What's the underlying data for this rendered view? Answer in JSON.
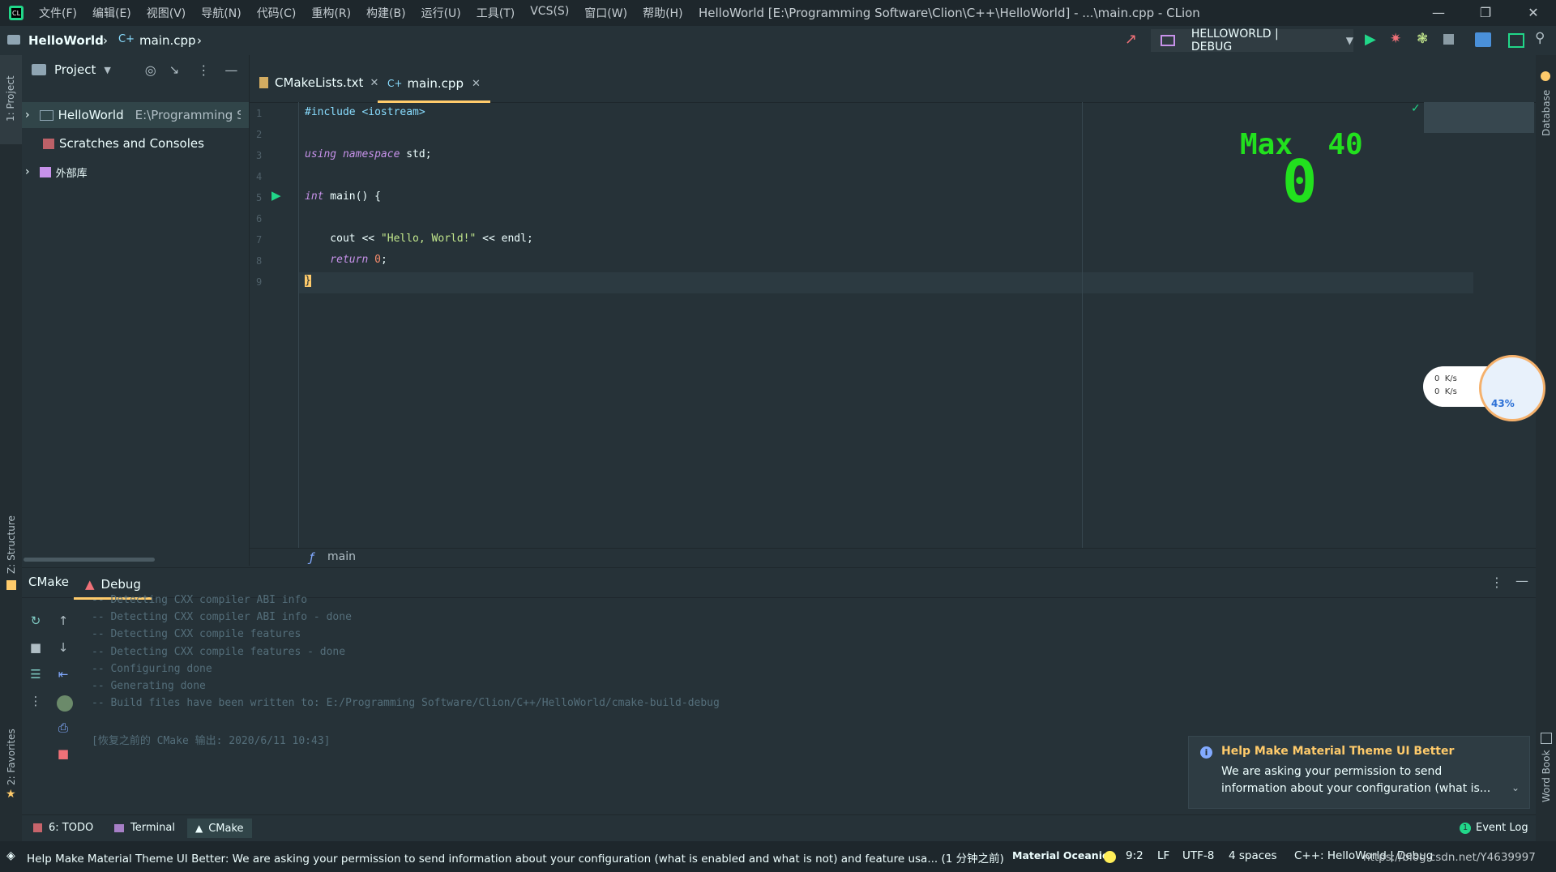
{
  "window": {
    "title": "HelloWorld [E:\\Programming Software\\Clion\\C++\\HelloWorld] - ...\\main.cpp - CLion",
    "menu": [
      "文件(F)",
      "编辑(E)",
      "视图(V)",
      "导航(N)",
      "代码(C)",
      "重构(R)",
      "构建(B)",
      "运行(U)",
      "工具(T)",
      "VCS(S)",
      "窗口(W)",
      "帮助(H)"
    ]
  },
  "nav": {
    "project": "HelloWorld",
    "file": "main.cpp",
    "run_config": "HELLOWORLD | DEBUG"
  },
  "left_strip": {
    "project": "1: Project",
    "structure": "Z: Structure",
    "favorites": "2: Favorites"
  },
  "right_strip": {
    "database": "Database",
    "wordbook": "Word Book"
  },
  "project_panel": {
    "title": "Project",
    "tree": [
      {
        "label": "HelloWorld",
        "path": "E:\\Programming Softv"
      },
      {
        "label": "Scratches and Consoles"
      },
      {
        "label": "外部库"
      }
    ]
  },
  "editor": {
    "tabs": [
      {
        "label": "CMakeLists.txt"
      },
      {
        "label": "main.cpp"
      }
    ],
    "line_numbers": [
      "1",
      "2",
      "3",
      "4",
      "5",
      "6",
      "7",
      "8",
      "9"
    ],
    "code": {
      "l1": "#include <iostream>",
      "l3a": "using namespace",
      "l3b": " std;",
      "l5a": "int",
      "l5b": " main() {",
      "l7a": "    cout << ",
      "l7b": "\"Hello, World!\"",
      "l7c": " << endl;",
      "l8a": "    return",
      "l8b": " 0",
      "l8c": ";",
      "l9": "}"
    },
    "breadcrumb_fn": "main"
  },
  "overlay": {
    "max_label": "Max  40",
    "digit": "0",
    "net_up": "0  K/s",
    "net_down": "0  K/s",
    "percent": "43%"
  },
  "bottom": {
    "tabs": [
      {
        "label": "CMake"
      },
      {
        "label": "Debug"
      }
    ],
    "console": [
      "-- Detecting CXX compiler ABI info",
      "-- Detecting CXX compiler ABI info - done",
      "-- Detecting CXX compile features",
      "-- Detecting CXX compile features - done",
      "-- Configuring done",
      "-- Generating done",
      "-- Build files have been written to: E:/Programming Software/Clion/C++/HelloWorld/cmake-build-debug",
      "",
      "[恢复之前的 CMake 输出: 2020/6/11 10:43]"
    ]
  },
  "notification": {
    "title": "Help Make Material Theme UI Better",
    "body1": "We are asking your permission to send",
    "body2": "information about your configuration (what is..."
  },
  "toolwindows": {
    "todo": "6: TODO",
    "terminal": "Terminal",
    "cmake": "CMake",
    "eventlog": "Event Log",
    "eventlog_count": "1"
  },
  "status": {
    "message": "Help Make Material Theme UI Better: We are asking your permission to send information about your configuration (what is enabled and what is not) and feature usa... (1 分钟之前)",
    "theme": "Material Oceanic",
    "position": "9:2",
    "line_sep": "LF",
    "encoding": "UTF-8",
    "indent": "4 spaces",
    "context": "C++: HelloWorld | Debug",
    "watermark": "https://blog.csdn.net/Y4639997"
  },
  "colors": {
    "accent": "#FFCB6B",
    "bg": "#263238",
    "green_overlay": "#22E01E"
  }
}
